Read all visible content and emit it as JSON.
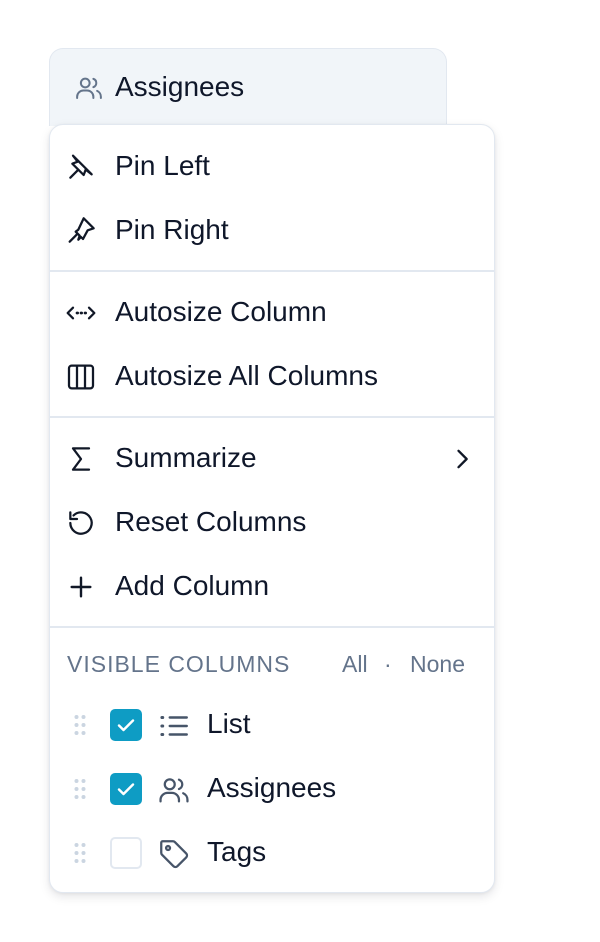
{
  "header": {
    "title": "Assignees",
    "icon": "users-icon"
  },
  "menu": {
    "pin_left": {
      "label": "Pin Left",
      "icon": "pin-left-icon"
    },
    "pin_right": {
      "label": "Pin Right",
      "icon": "pin-right-icon"
    },
    "autosize_column": {
      "label": "Autosize Column",
      "icon": "autosize-arrows-icon"
    },
    "autosize_all": {
      "label": "Autosize All Columns",
      "icon": "columns-icon"
    },
    "summarize": {
      "label": "Summarize",
      "icon": "sigma-icon",
      "submenu_icon": "chevron-right-icon"
    },
    "reset_columns": {
      "label": "Reset Columns",
      "icon": "reset-icon"
    },
    "add_column": {
      "label": "Add Column",
      "icon": "plus-icon"
    }
  },
  "visible_columns": {
    "heading": "VISIBLE COLUMNS",
    "all_label": "All",
    "separator": "·",
    "none_label": "None",
    "columns": [
      {
        "label": "List",
        "checked": true,
        "icon": "list-icon"
      },
      {
        "label": "Assignees",
        "checked": true,
        "icon": "users-icon"
      },
      {
        "label": "Tags",
        "checked": false,
        "icon": "tag-icon"
      }
    ]
  },
  "colors": {
    "accent": "#0e9cc4",
    "text": "#0f172a",
    "muted": "#64748b",
    "border": "#e2e8f0",
    "header_bg": "#f1f5f9"
  }
}
